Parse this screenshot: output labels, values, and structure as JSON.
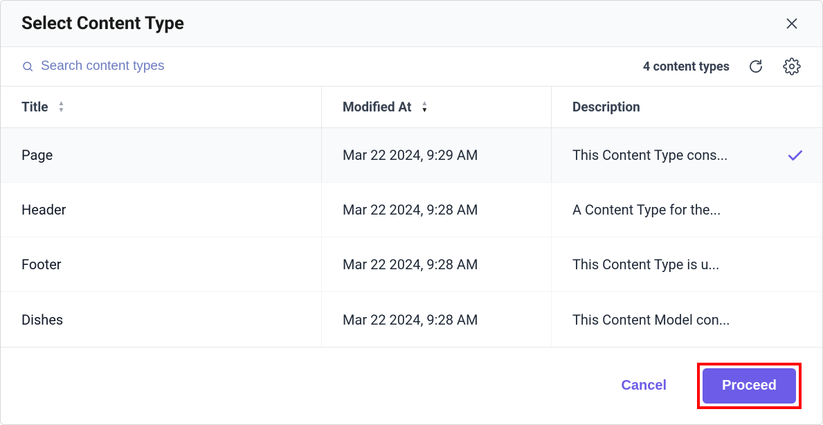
{
  "modal": {
    "title": "Select Content Type"
  },
  "toolbar": {
    "search_placeholder": "Search content types",
    "count_label": "4 content types"
  },
  "table": {
    "columns": {
      "title": "Title",
      "modified": "Modified At",
      "description": "Description"
    },
    "rows": [
      {
        "title": "Page",
        "modified": "Mar 22 2024, 9:29 AM",
        "description": "This Content Type cons...",
        "selected": true
      },
      {
        "title": "Header",
        "modified": "Mar 22 2024, 9:28 AM",
        "description": "A Content Type for the...",
        "selected": false
      },
      {
        "title": "Footer",
        "modified": "Mar 22 2024, 9:28 AM",
        "description": "This Content Type is u...",
        "selected": false
      },
      {
        "title": "Dishes",
        "modified": "Mar 22 2024, 9:28 AM",
        "description": "This Content Model con...",
        "selected": false
      }
    ]
  },
  "footer": {
    "cancel": "Cancel",
    "proceed": "Proceed"
  }
}
